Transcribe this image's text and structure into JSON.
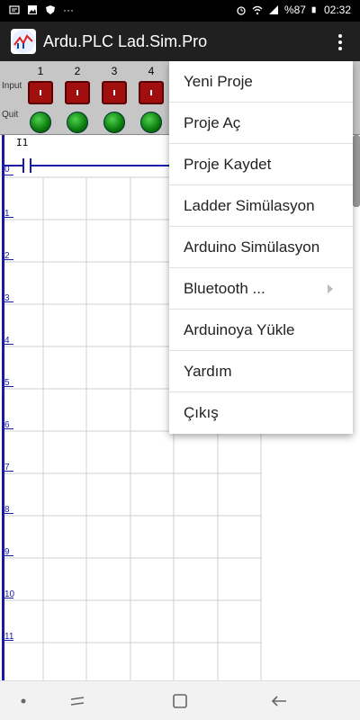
{
  "status_bar": {
    "battery": "%87",
    "time": "02:32",
    "more": "···"
  },
  "app": {
    "title": "Ardu.PLC Lad.Sim.Pro",
    "icon_text": "PLC"
  },
  "io_panel": {
    "input_label": "Input",
    "output_label": "Quit",
    "columns": [
      "1",
      "2",
      "3",
      "4"
    ]
  },
  "ladder": {
    "contact_label": "I1",
    "row_numbers": [
      "0",
      "1",
      "2",
      "3",
      "4",
      "5",
      "6",
      "7",
      "8",
      "9",
      "10",
      "11"
    ]
  },
  "menu": {
    "items": [
      {
        "label": "Yeni Proje"
      },
      {
        "label": "Proje Aç"
      },
      {
        "label": "Proje Kaydet"
      },
      {
        "label": "Ladder Simülasyon"
      },
      {
        "label": "Arduino Simülasyon"
      },
      {
        "label": "Bluetooth ...",
        "has_submenu": true
      },
      {
        "label": "Arduinoya Yükle"
      },
      {
        "label": "Yardım"
      },
      {
        "label": "Çıkış"
      }
    ]
  },
  "colors": {
    "app_bar": "#202020",
    "input_button": "#a10e0e",
    "output_led": "#1a9a1a",
    "rail": "#1a1aa5"
  }
}
